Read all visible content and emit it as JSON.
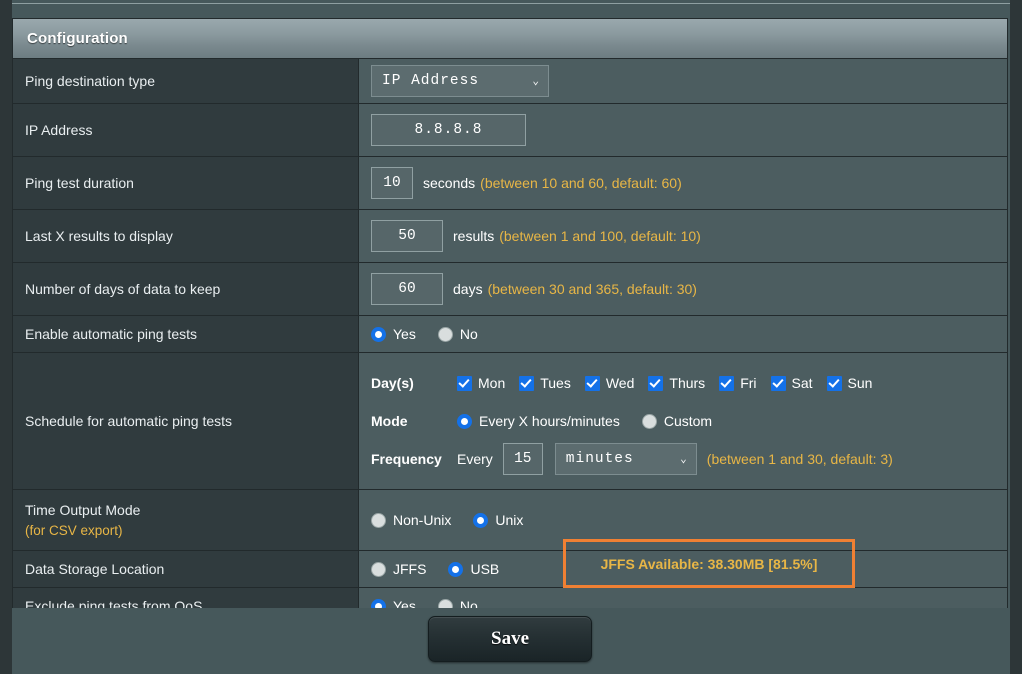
{
  "panel": {
    "title": "Configuration"
  },
  "rows": {
    "ping_destination_type": {
      "label": "Ping destination type",
      "select_value": "IP Address",
      "chevron": "⌄"
    },
    "ip_address": {
      "label": "IP Address",
      "value": "8.8.8.8"
    },
    "ping_test_duration": {
      "label": "Ping test duration",
      "value": "10",
      "unit": "seconds",
      "hint": "(between 10 and 60, default: 60)"
    },
    "last_x_results": {
      "label": "Last X results to display",
      "value": "50",
      "unit": "results",
      "hint": "(between 1 and 100, default: 10)"
    },
    "days_to_keep": {
      "label": "Number of days of data to keep",
      "value": "60",
      "unit": "days",
      "hint": "(between 30 and 365, default: 30)"
    },
    "enable_auto_ping": {
      "label": "Enable automatic ping tests",
      "options": [
        {
          "label": "Yes",
          "selected": true
        },
        {
          "label": "No",
          "selected": false
        }
      ]
    },
    "schedule": {
      "label": "Schedule for automatic ping tests",
      "days_key": "Day(s)",
      "days": [
        {
          "label": "Mon",
          "checked": true
        },
        {
          "label": "Tues",
          "checked": true
        },
        {
          "label": "Wed",
          "checked": true
        },
        {
          "label": "Thurs",
          "checked": true
        },
        {
          "label": "Fri",
          "checked": true
        },
        {
          "label": "Sat",
          "checked": true
        },
        {
          "label": "Sun",
          "checked": true
        }
      ],
      "mode_key": "Mode",
      "modes": [
        {
          "label": "Every X hours/minutes",
          "selected": true
        },
        {
          "label": "Custom",
          "selected": false
        }
      ],
      "frequency_key": "Frequency",
      "every_label": "Every",
      "frequency_value": "15",
      "frequency_unit": "minutes",
      "frequency_chevron": "⌄",
      "frequency_hint": "(between 1 and 30, default: 3)"
    },
    "time_output_mode": {
      "label": "Time Output Mode",
      "sublabel": "(for CSV export)",
      "options": [
        {
          "label": "Non-Unix",
          "selected": false
        },
        {
          "label": "Unix",
          "selected": true
        }
      ]
    },
    "data_storage_location": {
      "label": "Data Storage Location",
      "options": [
        {
          "label": "JFFS",
          "selected": false
        },
        {
          "label": "USB",
          "selected": true
        }
      ],
      "callout": "JFFS Available: 38.30MB [81.5%]"
    },
    "exclude_qos": {
      "label": "Exclude ping tests from QoS",
      "options": [
        {
          "label": "Yes",
          "selected": true
        },
        {
          "label": "No",
          "selected": false
        }
      ]
    }
  },
  "footer": {
    "save_label": "Save"
  },
  "colors": {
    "accent_blue": "#1471e8",
    "hint_amber": "#e8b646",
    "callout_orange": "#f08033",
    "label_bg": "#303b3e",
    "value_bg": "#4c5d60"
  }
}
